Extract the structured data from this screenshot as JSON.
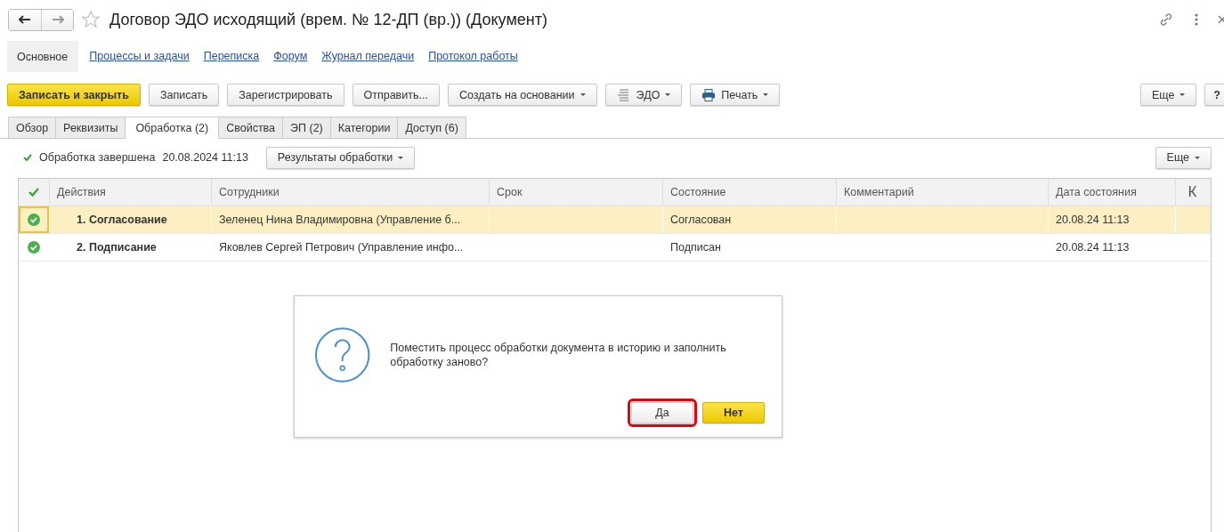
{
  "window": {
    "title": "Договор ЭДО исходящий (врем. № 12-ДП (вр.)) (Документ)",
    "favorite": false
  },
  "nav": [
    {
      "label": "Основное",
      "selected": true
    },
    {
      "label": "Процессы и задачи",
      "selected": false
    },
    {
      "label": "Переписка",
      "selected": false
    },
    {
      "label": "Форум",
      "selected": false
    },
    {
      "label": "Журнал передачи",
      "selected": false
    },
    {
      "label": "Протокол работы",
      "selected": false
    }
  ],
  "toolbar": [
    {
      "label": "Записать и закрыть",
      "kind": "primary"
    },
    {
      "label": "Записать",
      "kind": "plain"
    },
    {
      "label": "Зарегистрировать",
      "kind": "plain"
    },
    {
      "label": "Отправить...",
      "kind": "plain"
    },
    {
      "label": "Создать на основании",
      "kind": "dropdown"
    },
    {
      "label": "ЭДО",
      "kind": "edo"
    },
    {
      "label": "Печать",
      "kind": "print"
    }
  ],
  "toolbar_right": {
    "more": "Еще",
    "help": "?"
  },
  "tabs": [
    {
      "label": "Обзор",
      "selected": false
    },
    {
      "label": "Реквизиты",
      "selected": false
    },
    {
      "label": "Обработка (2)",
      "selected": true
    },
    {
      "label": "Свойства",
      "selected": false
    },
    {
      "label": "ЭП (2)",
      "selected": false
    },
    {
      "label": "Категории",
      "selected": false
    },
    {
      "label": "Доступ (6)",
      "selected": false
    }
  ],
  "status": {
    "text": "Обработка завершена",
    "date": "20.08.2024 11:13",
    "results_button": "Результаты обработки",
    "more": "Еще"
  },
  "table": {
    "columns": [
      "Действия",
      "Сотрудники",
      "Срок",
      "Состояние",
      "Комментарий",
      "Дата состояния",
      "К"
    ],
    "rows": [
      {
        "selected": true,
        "done": true,
        "action": "1. Согласование",
        "employees": "Зеленец Нина Владимировна (Управление б...",
        "state": "Согласован",
        "date": "20.08.24 11:13"
      },
      {
        "selected": false,
        "done": true,
        "action": "2. Подписание",
        "employees": "Яковлев Сергей Петрович (Управление инфо...",
        "state": "Подписан",
        "date": "20.08.24 11:13"
      }
    ]
  },
  "dialog": {
    "message": "Поместить процесс обработки документа в историю и заполнить обработку заново?",
    "buttons": [
      {
        "label": "Да",
        "kind": "plain",
        "highlighted": true
      },
      {
        "label": "Нет",
        "kind": "primary",
        "highlighted": false
      }
    ]
  }
}
